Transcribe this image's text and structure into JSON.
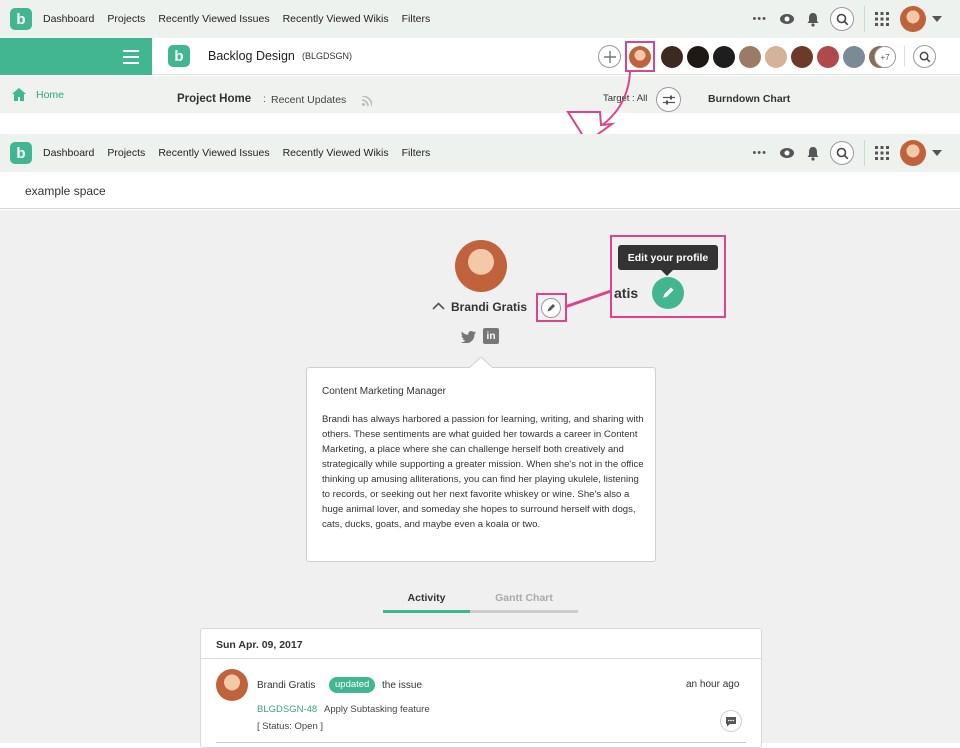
{
  "nav": {
    "logo_letter": "b",
    "links": [
      "Dashboard",
      "Projects",
      "Recently Viewed Issues",
      "Recently Viewed Wikis",
      "Filters"
    ],
    "more": "•••"
  },
  "project": {
    "name": "Backlog Design",
    "key": "(BLGDSGN)",
    "more_members": "+7"
  },
  "subbar": {
    "home": "Home",
    "project_home": "Project Home",
    "colon": ":",
    "recent_updates": "Recent Updates",
    "target": "Target : All",
    "burndown": "Burndown Chart"
  },
  "space": {
    "name": "example space"
  },
  "profile": {
    "name": "Brandi Gratis",
    "tooltip": "Edit your profile",
    "zoom_name_fragment": "atis",
    "title": "Content Marketing Manager",
    "bio": "Brandi has always harbored a passion for learning, writing, and sharing with others. These sentiments are what guided her towards a career in Content Marketing, a place where she can challenge herself both creatively and strategically while supporting a greater mission. When she's not in the office thinking up amusing alliterations, you can find her playing ukulele, listening to records, or seeking out her next favorite whiskey or wine. She's also a huge animal lover, and someday she hopes to surround herself with dogs, cats, ducks, goats, and maybe even a koala or two."
  },
  "tabs": {
    "activity": "Activity",
    "gantt": "Gantt Chart"
  },
  "activity": {
    "date": "Sun Apr. 09, 2017",
    "user": "Brandi Gratis",
    "badge": "updated",
    "action": "the issue",
    "time": "an hour ago",
    "issue_key": "BLGDSGN-48",
    "issue_title": "Apply Subtasking feature",
    "status": "[ Status: Open ]"
  },
  "colors": {
    "brand": "#42b591",
    "highlight": "#d9458a",
    "link": "#3aa07f"
  }
}
